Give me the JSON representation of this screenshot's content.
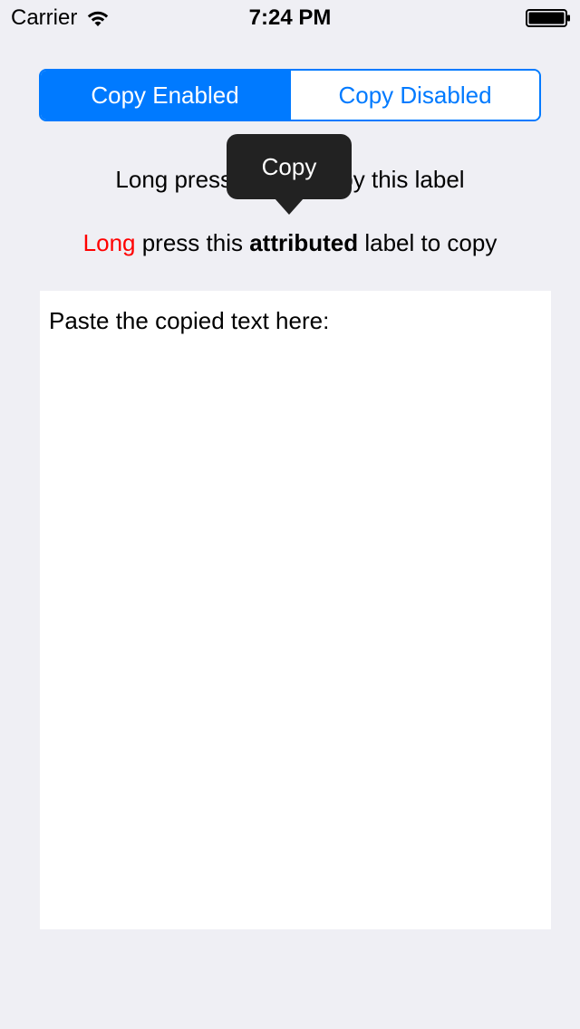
{
  "status_bar": {
    "carrier": "Carrier",
    "time": "7:24 PM",
    "wifi_icon": "wifi-icon",
    "battery_icon": "battery-full-icon"
  },
  "segmented_control": {
    "segments": [
      {
        "label": "Copy Enabled",
        "selected": true
      },
      {
        "label": "Copy Disabled",
        "selected": false
      }
    ],
    "accent_color": "#007aff"
  },
  "plain_label": {
    "text_before_menu": "Long press ",
    "text_after_menu": "py this label"
  },
  "attributed_label": {
    "red_part": "Long",
    "part2": " press this ",
    "bold_part": "attributed",
    "part4": " label to copy",
    "red_color": "#ff0000"
  },
  "copy_menu": {
    "label": "Copy"
  },
  "text_view": {
    "content": "Paste the copied text here:"
  }
}
